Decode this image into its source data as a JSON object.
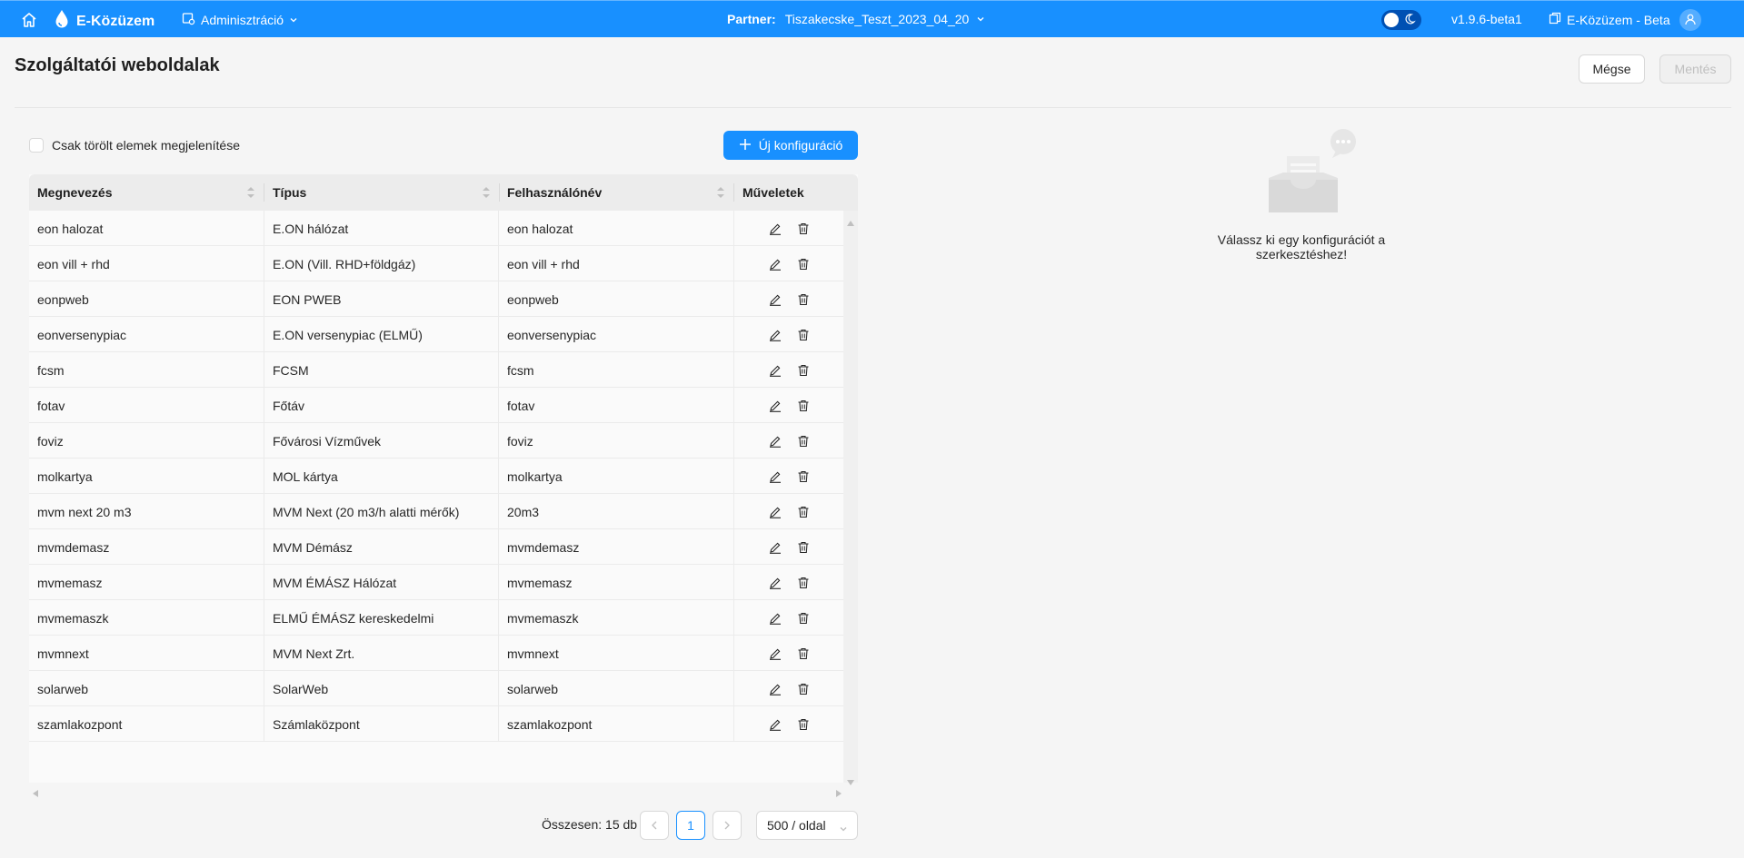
{
  "header": {
    "brand": "E-Közüzem",
    "admin_menu": "Adminisztráció",
    "partner_label": "Partner:",
    "partner_value": "Tiszakecske_Teszt_2023_04_20",
    "version": "v1.9.6-beta1",
    "environment": "E-Közüzem - Beta",
    "colors": {
      "primary": "#1890ff"
    }
  },
  "page": {
    "title": "Szolgáltatói weboldalak",
    "cancel_label": "Mégse",
    "save_label": "Mentés"
  },
  "toolbar": {
    "show_deleted_label": "Csak törölt elemek megjelenítése",
    "show_deleted_checked": false,
    "new_config_label": "Új konfiguráció"
  },
  "table": {
    "columns": [
      "Megnevezés",
      "Típus",
      "Felhasználónév",
      "Műveletek"
    ],
    "rows": [
      [
        "eon halozat",
        "E.ON hálózat",
        "eon halozat"
      ],
      [
        "eon vill + rhd",
        "E.ON (Vill. RHD+földgáz)",
        "eon vill + rhd"
      ],
      [
        "eonpweb",
        "EON PWEB",
        "eonpweb"
      ],
      [
        "eonversenypiac",
        "E.ON versenypiac (ELMŰ)",
        "eonversenypiac"
      ],
      [
        "fcsm",
        "FCSM",
        "fcsm"
      ],
      [
        "fotav",
        "Főtáv",
        "fotav"
      ],
      [
        "foviz",
        "Fővárosi Vízművek",
        "foviz"
      ],
      [
        "molkartya",
        "MOL kártya",
        "molkartya"
      ],
      [
        "mvm next 20 m3",
        "MVM Next (20 m3/h alatti mérők)",
        "20m3"
      ],
      [
        "mvmdemasz",
        "MVM Démász",
        "mvmdemasz"
      ],
      [
        "mvmemasz",
        "MVM ÉMÁSZ Hálózat",
        "mvmemasz"
      ],
      [
        "mvmemaszk",
        "ELMŰ ÉMÁSZ kereskedelmi",
        "mvmemaszk"
      ],
      [
        "mvmnext",
        "MVM Next Zrt.",
        "mvmnext"
      ],
      [
        "solarweb",
        "SolarWeb",
        "solarweb"
      ],
      [
        "szamlakozpont",
        "Számlaközpont",
        "szamlakozpont"
      ]
    ],
    "row_icons": [
      "edit-icon",
      "delete-icon"
    ]
  },
  "pagination": {
    "total_label": "Összesen: 15 db",
    "current_page": "1",
    "page_size": "500 / oldal"
  },
  "empty_state": {
    "message": "Válassz ki egy konfigurációt a szerkesztéshez!"
  }
}
